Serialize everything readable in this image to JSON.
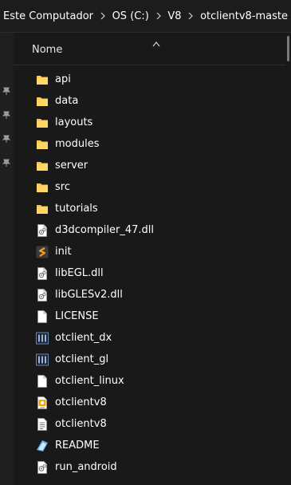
{
  "breadcrumb": {
    "items": [
      "Este Computador",
      "OS (C:)",
      "V8",
      "otclientv8-maste"
    ]
  },
  "column_header": {
    "name_label": "Nome"
  },
  "files": [
    {
      "name": "api",
      "icon": "folder-icon"
    },
    {
      "name": "data",
      "icon": "folder-icon"
    },
    {
      "name": "layouts",
      "icon": "folder-icon"
    },
    {
      "name": "modules",
      "icon": "folder-icon"
    },
    {
      "name": "server",
      "icon": "folder-icon"
    },
    {
      "name": "src",
      "icon": "folder-icon"
    },
    {
      "name": "tutorials",
      "icon": "folder-icon"
    },
    {
      "name": "d3dcompiler_47.dll",
      "icon": "dll-file-icon"
    },
    {
      "name": "init",
      "icon": "lua-script-icon"
    },
    {
      "name": "libEGL.dll",
      "icon": "dll-file-icon"
    },
    {
      "name": "libGLESv2.dll",
      "icon": "dll-file-icon"
    },
    {
      "name": "LICENSE",
      "icon": "blank-file-icon"
    },
    {
      "name": "otclient_dx",
      "icon": "executable-icon"
    },
    {
      "name": "otclient_gl",
      "icon": "executable-icon"
    },
    {
      "name": "otclient_linux",
      "icon": "blank-file-icon"
    },
    {
      "name": "otclientv8",
      "icon": "apk-file-icon"
    },
    {
      "name": "otclientv8",
      "icon": "text-file-icon"
    },
    {
      "name": "README",
      "icon": "markdown-file-icon"
    },
    {
      "name": "run_android",
      "icon": "batch-file-icon"
    }
  ],
  "colors": {
    "background": "#191919",
    "folder": "#f8c644",
    "text": "#ffffff"
  }
}
